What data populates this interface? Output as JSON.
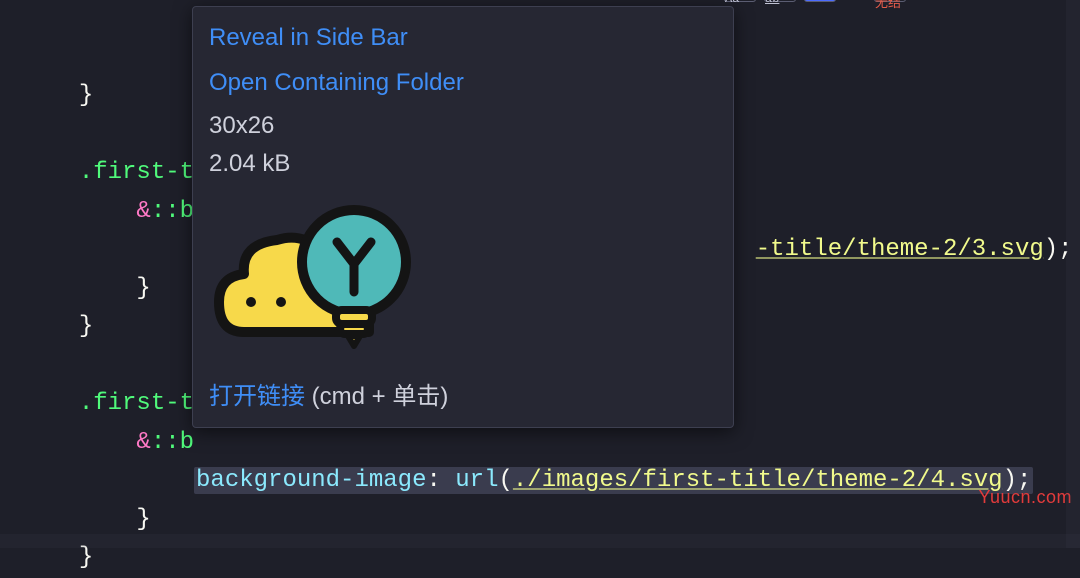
{
  "code": {
    "selector": ".first-t",
    "amp": "&",
    "pseudo_partial": "::b",
    "brace_open": "{",
    "brace_close": "}",
    "css_property": "background-image",
    "colon": ":",
    "func_url": "url",
    "paren_open": "(",
    "paren_close": ")",
    "semicolon": ";",
    "url_tail_1": "-title/theme-2/3.svg",
    "url_full_2": "./images/first-title/theme-2/4.svg"
  },
  "hover": {
    "reveal_link": "Reveal in Side Bar",
    "open_folder_link": "Open Containing Folder",
    "dimensions": "30x26",
    "filesize": "2.04 kB",
    "bottom_link": "打开链接",
    "bottom_hint": " (cmd + 单击)"
  },
  "toolbar": {
    "aa": "Aa",
    "ab": "ab",
    "cn": "无结"
  },
  "watermark": "Yuucn.com"
}
